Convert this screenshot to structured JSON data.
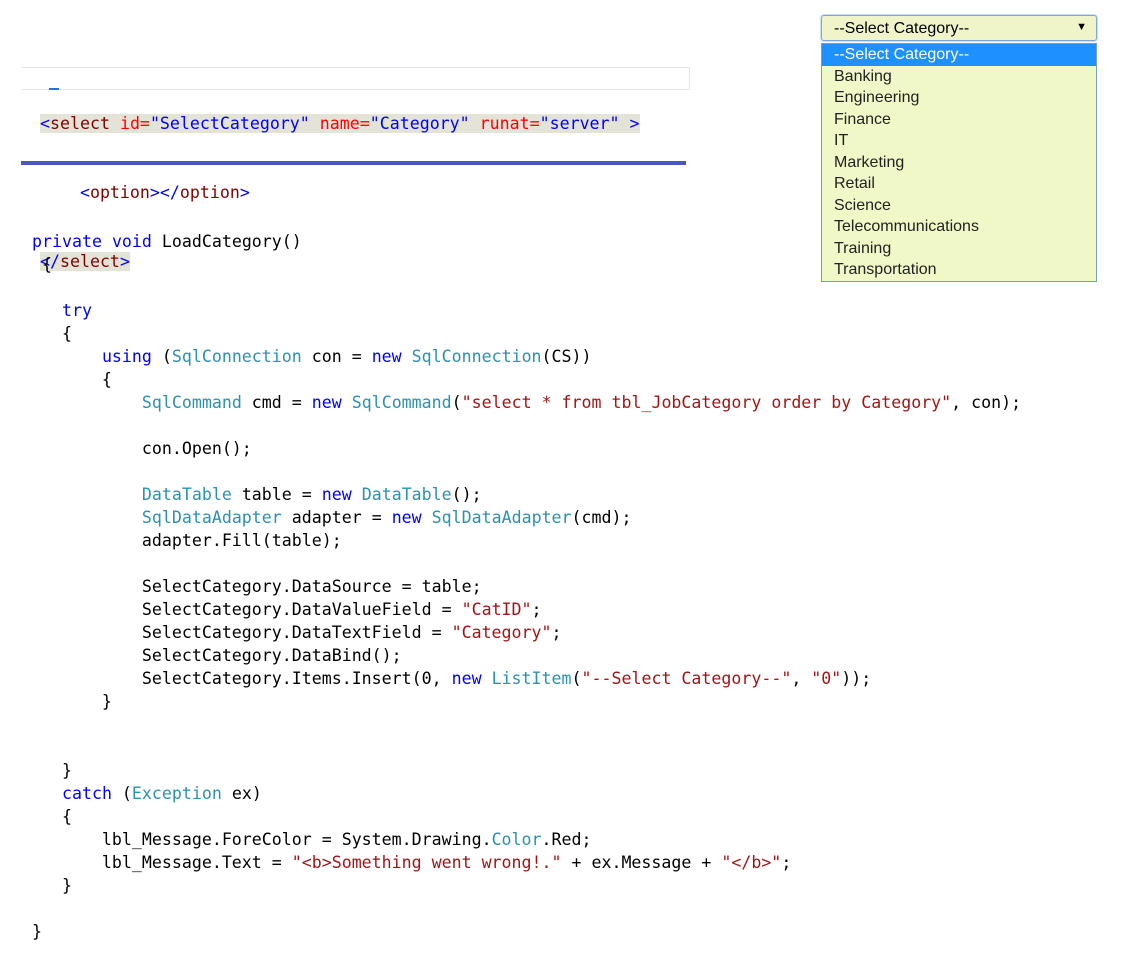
{
  "markup": {
    "lines": [
      [
        "<",
        "select",
        " ",
        "id=",
        "\"SelectCategory\"",
        " ",
        "name=",
        "\"Category\"",
        " ",
        "runat=",
        "\"server\"",
        " >"
      ],
      [
        "    <",
        "option",
        "></",
        "option",
        ">"
      ],
      [
        "</",
        "select",
        ">"
      ]
    ]
  },
  "dropdown": {
    "selected": "--Select Category--",
    "arrow": "▼",
    "options": [
      "--Select Category--",
      "Banking",
      "Engineering",
      "Finance",
      "IT",
      "Marketing",
      "Retail",
      "Science",
      "Telecommunications",
      "Training",
      "Transportation"
    ],
    "highlighted_index": 0
  },
  "code": {
    "lines": [
      [
        [
          "kw",
          "private"
        ],
        [
          "pl",
          " "
        ],
        [
          "kw",
          "void"
        ],
        [
          "pl",
          " LoadCategory()"
        ]
      ],
      [
        [
          "pl",
          " {"
        ]
      ],
      [
        [
          "pl",
          ""
        ]
      ],
      [
        [
          "pl",
          "   "
        ],
        [
          "kw",
          "try"
        ]
      ],
      [
        [
          "pl",
          "   {"
        ]
      ],
      [
        [
          "pl",
          "       "
        ],
        [
          "kw",
          "using"
        ],
        [
          "pl",
          " ("
        ],
        [
          "ty",
          "SqlConnection"
        ],
        [
          "pl",
          " con = "
        ],
        [
          "kw",
          "new"
        ],
        [
          "pl",
          " "
        ],
        [
          "ty",
          "SqlConnection"
        ],
        [
          "pl",
          "(CS))"
        ]
      ],
      [
        [
          "pl",
          "       {"
        ]
      ],
      [
        [
          "pl",
          "           "
        ],
        [
          "ty",
          "SqlCommand"
        ],
        [
          "pl",
          " cmd = "
        ],
        [
          "kw",
          "new"
        ],
        [
          "pl",
          " "
        ],
        [
          "ty",
          "SqlCommand"
        ],
        [
          "pl",
          "("
        ],
        [
          "str",
          "\"select * from tbl_JobCategory order by Category\""
        ],
        [
          "pl",
          ", con);"
        ]
      ],
      [
        [
          "pl",
          ""
        ]
      ],
      [
        [
          "pl",
          "           con.Open();"
        ]
      ],
      [
        [
          "pl",
          ""
        ]
      ],
      [
        [
          "pl",
          "           "
        ],
        [
          "ty",
          "DataTable"
        ],
        [
          "pl",
          " table = "
        ],
        [
          "kw",
          "new"
        ],
        [
          "pl",
          " "
        ],
        [
          "ty",
          "DataTable"
        ],
        [
          "pl",
          "();"
        ]
      ],
      [
        [
          "pl",
          "           "
        ],
        [
          "ty",
          "SqlDataAdapter"
        ],
        [
          "pl",
          " adapter = "
        ],
        [
          "kw",
          "new"
        ],
        [
          "pl",
          " "
        ],
        [
          "ty",
          "SqlDataAdapter"
        ],
        [
          "pl",
          "(cmd);"
        ]
      ],
      [
        [
          "pl",
          "           adapter.Fill(table);"
        ]
      ],
      [
        [
          "pl",
          ""
        ]
      ],
      [
        [
          "pl",
          "           SelectCategory.DataSource = table;"
        ]
      ],
      [
        [
          "pl",
          "           SelectCategory.DataValueField = "
        ],
        [
          "str",
          "\"CatID\""
        ],
        [
          "pl",
          ";"
        ]
      ],
      [
        [
          "pl",
          "           SelectCategory.DataTextField = "
        ],
        [
          "str",
          "\"Category\""
        ],
        [
          "pl",
          ";"
        ]
      ],
      [
        [
          "pl",
          "           SelectCategory.DataBind();"
        ]
      ],
      [
        [
          "pl",
          "           SelectCategory.Items.Insert(0, "
        ],
        [
          "kw",
          "new"
        ],
        [
          "pl",
          " "
        ],
        [
          "ty",
          "ListItem"
        ],
        [
          "pl",
          "("
        ],
        [
          "str",
          "\"--Select Category--\""
        ],
        [
          "pl",
          ", "
        ],
        [
          "str",
          "\"0\""
        ],
        [
          "pl",
          "));"
        ]
      ],
      [
        [
          "pl",
          "       }"
        ]
      ],
      [
        [
          "pl",
          ""
        ]
      ],
      [
        [
          "pl",
          ""
        ]
      ],
      [
        [
          "pl",
          "   }"
        ]
      ],
      [
        [
          "pl",
          "   "
        ],
        [
          "kw",
          "catch"
        ],
        [
          "pl",
          " ("
        ],
        [
          "ty",
          "Exception"
        ],
        [
          "pl",
          " ex)"
        ]
      ],
      [
        [
          "pl",
          "   {"
        ]
      ],
      [
        [
          "pl",
          "       lbl_Message.ForeColor = System.Drawing."
        ],
        [
          "ty",
          "Color"
        ],
        [
          "pl",
          ".Red;"
        ]
      ],
      [
        [
          "pl",
          "       lbl_Message.Text = "
        ],
        [
          "str",
          "\"<b>Something went wrong!.\""
        ],
        [
          "pl",
          " + ex.Message + "
        ],
        [
          "str",
          "\"</b>\""
        ],
        [
          "pl",
          ";"
        ]
      ],
      [
        [
          "pl",
          "   }"
        ]
      ],
      [
        [
          "pl",
          ""
        ]
      ],
      [
        [
          "pl",
          "}"
        ]
      ]
    ]
  }
}
